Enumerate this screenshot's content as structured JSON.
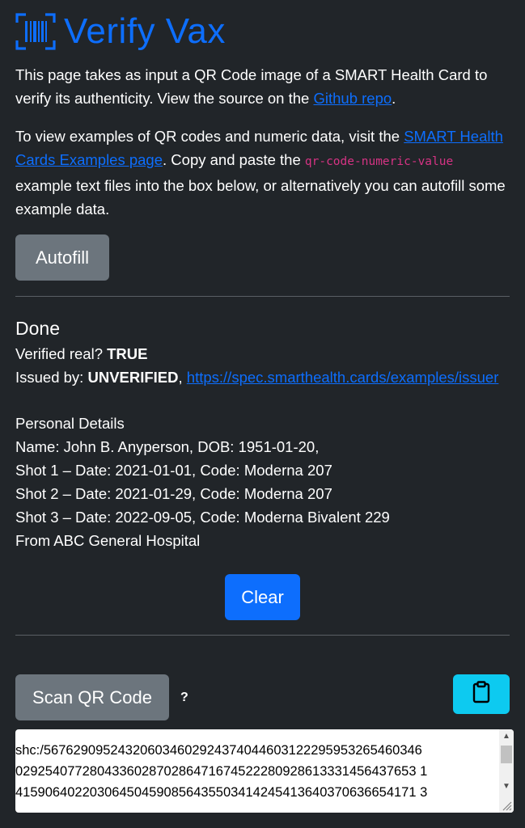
{
  "header": {
    "title": "Verify Vax",
    "logo_icon": "barcode-scan-icon",
    "accent_color": "#0d6efd"
  },
  "intro": {
    "text_before_link": "This page takes as input a QR Code image of a SMART Health Card to verify its authenticity. View the source on the ",
    "github_link": "Github repo",
    "text_after_link": "."
  },
  "examples": {
    "text_before_link": "To view examples of QR codes and numeric data, visit the ",
    "examples_link": "SMART Health Cards Examples page",
    "text_mid": ". Copy and paste the ",
    "code": "qr-code-numeric-value",
    "text_after": " example text files into the box below, or alternatively you can autofill some example data."
  },
  "buttons": {
    "autofill": "Autofill",
    "clear": "Clear",
    "scan": "Scan QR Code",
    "help": "?",
    "clipboard_icon": "clipboard-icon"
  },
  "result": {
    "status": "Done",
    "verified_label": "Verified real? ",
    "verified_value": "TRUE",
    "issuer_label": "Issued by: ",
    "issuer_value": "UNVERIFIED",
    "issuer_sep": ", ",
    "issuer_link": "https://spec.smarthealth.cards/examples/issuer"
  },
  "details": {
    "heading": "Personal Details",
    "name_line": "Name: John B. Anyperson, DOB: 1951-01-20,",
    "shots": [
      "Shot 1 – Date: 2021-01-01, Code: Moderna 207",
      "Shot 2 – Date: 2021-01-29, Code: Moderna 207",
      "Shot 3 – Date: 2022-09-05, Code: Moderna Bivalent 229"
    ],
    "from_line": "From ABC General Hospital"
  },
  "textarea": {
    "lines": [
      "shc:/567629095243206034602924374044603122295953265460346",
      "029254077280433602870286471674522280928613331456437653 1",
      "415906402203064504590856435503414245413640370636654171 3"
    ]
  },
  "colors": {
    "background": "#212529",
    "secondary_button": "#6c757d",
    "primary_button": "#0d6efd",
    "info_button": "#0dcaf0",
    "code_text": "#d63384"
  }
}
